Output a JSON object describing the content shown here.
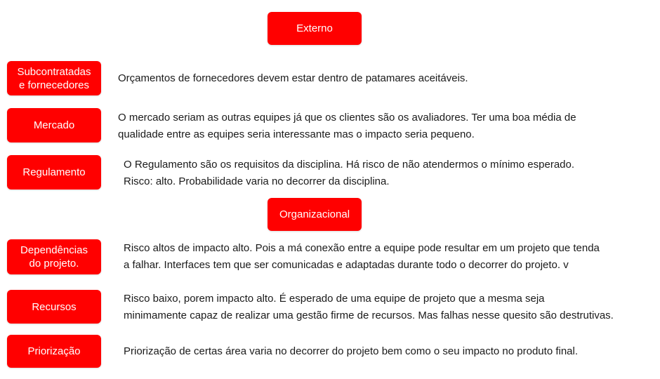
{
  "sections": {
    "externo": "Externo",
    "organizacional": "Organizacional"
  },
  "items": {
    "subcontratadas": {
      "label": "Subcontratadas\ne fornecedores",
      "lines": [
        "Orçamentos de fornecedores devem estar dentro de patamares aceitáveis."
      ]
    },
    "mercado": {
      "label": "Mercado",
      "lines": [
        "O mercado seriam as outras equipes já que os clientes são os avaliadores. Ter uma boa média de",
        "qualidade entre as equipes seria interessante mas o impacto seria pequeno."
      ]
    },
    "regulamento": {
      "label": "Regulamento",
      "lines": [
        "O Regulamento são os requisitos da disciplina. Há risco de não atendermos o mínimo esperado.",
        "Risco: alto. Probabilidade varia no decorrer da disciplina."
      ]
    },
    "dependencias": {
      "label": "Dependências\ndo projeto.",
      "lines": [
        "Risco altos de impacto alto. Pois a má conexão entre a equipe pode resultar em um projeto que tenda",
        "a falhar. Interfaces tem que ser comunicadas e adaptadas durante todo o decorrer do projeto. v"
      ]
    },
    "recursos": {
      "label": "Recursos",
      "lines": [
        "Risco baixo, porem impacto alto. É esperado de uma equipe de projeto que a mesma seja",
        "minimamente capaz de realizar uma gestão firme de recursos. Mas falhas nesse quesito são destrutivas."
      ]
    },
    "priorizacao": {
      "label": "Priorização",
      "lines": [
        "Priorização de certas área varia no decorrer do projeto bem como o seu impacto no produto final."
      ]
    }
  },
  "colors": {
    "box_fill": "#ff0000",
    "box_text": "#ffffff",
    "body_text": "#1a1a1a"
  }
}
